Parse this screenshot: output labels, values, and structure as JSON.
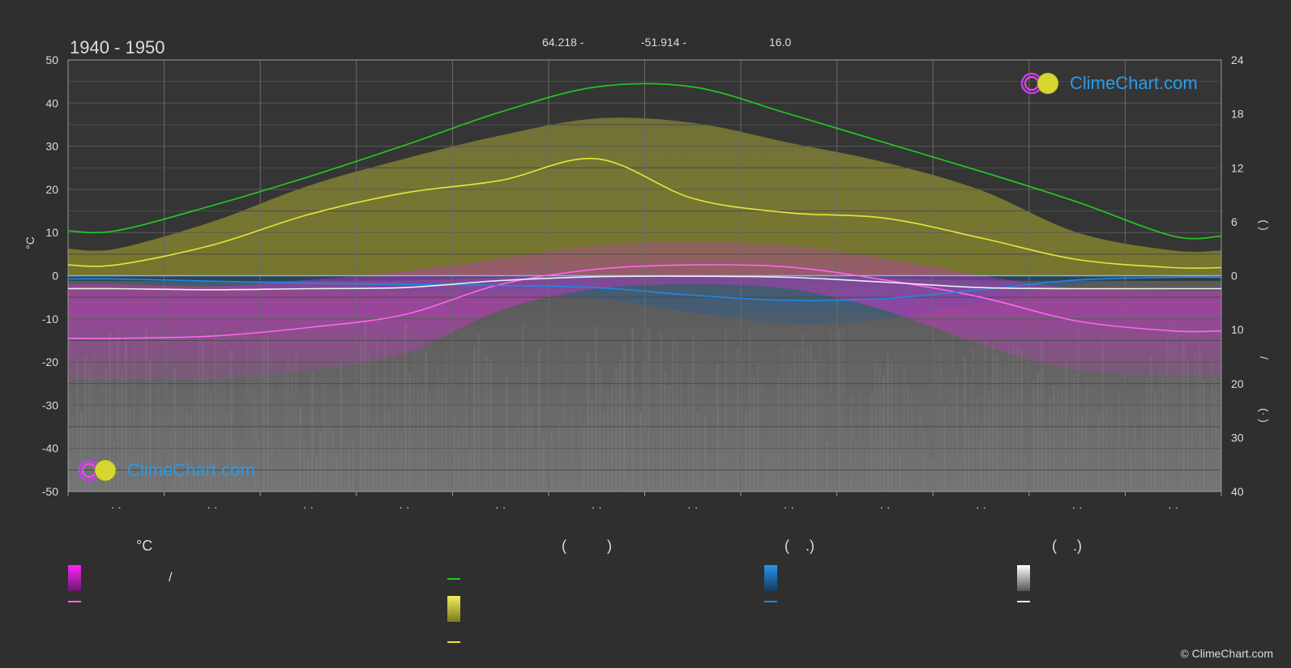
{
  "header": {
    "period": "1940 - 1950",
    "coord_lat": "64.218 -",
    "coord_lon": "-51.914 -",
    "elevation": "16.0"
  },
  "axes": {
    "left_unit": "°C",
    "left_ticks": [
      50,
      40,
      30,
      20,
      10,
      0,
      -10,
      -20,
      -30,
      -40,
      -50
    ],
    "right_ticks_top": [
      24,
      18,
      12,
      6,
      0
    ],
    "right_ticks_bottom": [
      10,
      20,
      30,
      40
    ],
    "right_label_top": "(   )",
    "right_label_slash": "/",
    "right_label_bottom": "(·   )",
    "month_labels": [
      "· ·",
      "· ·",
      "· ·",
      "· ·",
      "· ·",
      "· ·",
      "· ·",
      "· ·",
      "· ·",
      "· ·",
      "· ·",
      "· ·"
    ]
  },
  "chart_data": {
    "type": "line",
    "x_months": [
      1,
      2,
      3,
      4,
      5,
      6,
      7,
      8,
      9,
      10,
      11,
      12
    ],
    "left_ylim": [
      -50,
      50
    ],
    "right_top_ylim": [
      0,
      24
    ],
    "right_bottom_ylim": [
      0,
      40
    ],
    "grid": true,
    "series": [
      {
        "key": "daylight",
        "axis": "right_top",
        "color": "#22cc22",
        "values": [
          5.0,
          7.8,
          11.0,
          14.5,
          18.2,
          21.0,
          21.0,
          18.0,
          14.8,
          11.6,
          8.2,
          4.4
        ]
      },
      {
        "key": "sunshine",
        "axis": "right_top",
        "color": "#e6e63a",
        "values": [
          1.2,
          3.4,
          6.8,
          9.2,
          10.6,
          13.0,
          8.6,
          7.0,
          6.4,
          4.2,
          1.8,
          0.9
        ]
      },
      {
        "key": "temp_max_mean",
        "axis": "left",
        "color": "#ff66ee",
        "values": [
          -14.5,
          -14.0,
          -12.0,
          -9.0,
          -2.0,
          1.5,
          2.5,
          2.0,
          -1.0,
          -5.0,
          -10.5,
          -12.8
        ]
      },
      {
        "key": "precip_mean",
        "axis": "right_bottom",
        "color": "#1e88e5",
        "values": [
          0.6,
          1.0,
          1.4,
          1.6,
          1.8,
          2.2,
          3.6,
          4.6,
          4.2,
          2.6,
          0.8,
          0.3
        ]
      },
      {
        "key": "snow_mean",
        "axis": "right_bottom",
        "color": "#eeeeee",
        "values": [
          2.4,
          2.6,
          2.4,
          2.2,
          0.9,
          0.2,
          0.1,
          0.3,
          1.2,
          2.2,
          2.4,
          2.4
        ]
      }
    ],
    "bands": {
      "sunshine_band_top": [
        3.0,
        6.0,
        10.0,
        13.0,
        15.6,
        17.5,
        17.0,
        14.8,
        12.6,
        9.5,
        4.8,
        2.8
      ],
      "temp_band_top": [
        -2.0,
        -2.5,
        -1.0,
        1.0,
        4.0,
        7.0,
        8.0,
        7.0,
        4.0,
        0.0,
        -3.0,
        -3.5
      ],
      "temp_band_bottom": [
        -24.0,
        -24.0,
        -22.0,
        -18.0,
        -8.0,
        -3.0,
        -2.0,
        -3.0,
        -8.0,
        -16.0,
        -22.0,
        -23.0
      ]
    }
  },
  "legend": {
    "col1_head": "°C",
    "col1_row1": "/",
    "col2_head": "(          )",
    "col3_head": "(    .)",
    "col4_head": "(    .)"
  },
  "colors": {
    "background": "#2f2f2f",
    "plot_background": "#353535",
    "grid": "#5a5a5a",
    "band_temp": "#cc33cc",
    "band_sun": "#b8b83a",
    "band_precip": "#1b5f9c",
    "band_snow": "#8a8a8a",
    "logo_text": "#2b9be8"
  },
  "branding": {
    "logo_text": "ClimeChart.com",
    "copyright": "© ClimeChart.com"
  }
}
